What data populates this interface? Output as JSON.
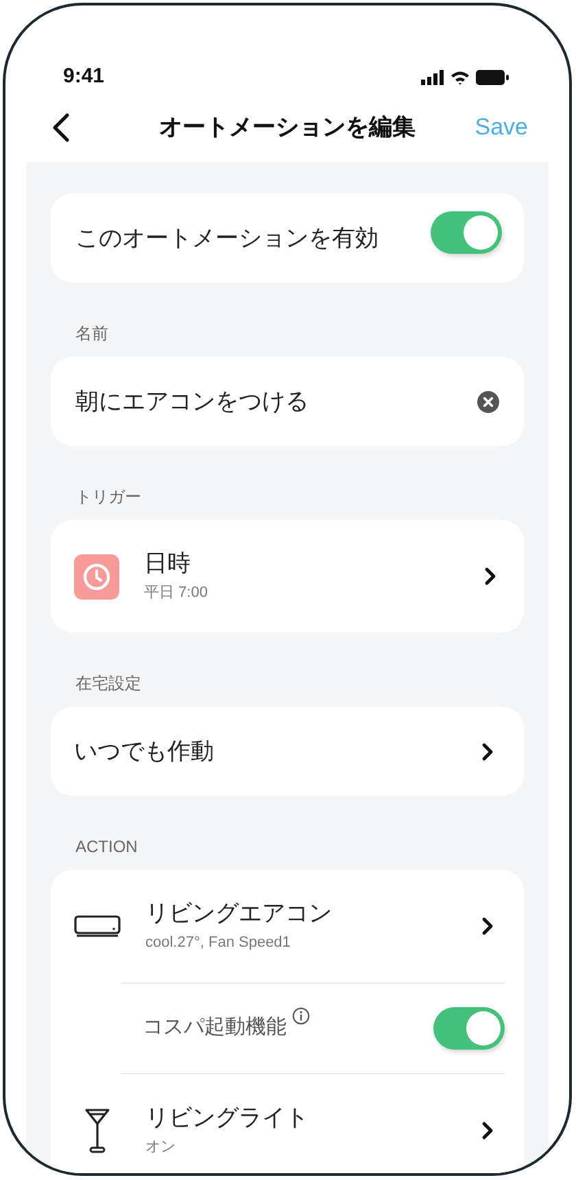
{
  "status_bar": {
    "time": "9:41"
  },
  "header": {
    "title": "オートメーションを編集",
    "action": "Save"
  },
  "enable": {
    "label": "このオートメーションを有効",
    "on": true
  },
  "name_section": {
    "label": "名前",
    "value": "朝にエアコンをつける"
  },
  "trigger_section": {
    "label": "トリガー",
    "title": "日時",
    "subtitle": "平日 7:00"
  },
  "presence_section": {
    "label": "在宅設定",
    "value": "いつでも作動"
  },
  "action_section": {
    "label": "ACTION",
    "items": [
      {
        "kind": "device",
        "title": "リビングエアコン",
        "subtitle": "cool.27°, Fan Speed1"
      },
      {
        "kind": "option",
        "label": "コスパ起動機能",
        "on": true
      },
      {
        "kind": "device",
        "title": "リビングライト",
        "subtitle": "オン"
      }
    ]
  }
}
